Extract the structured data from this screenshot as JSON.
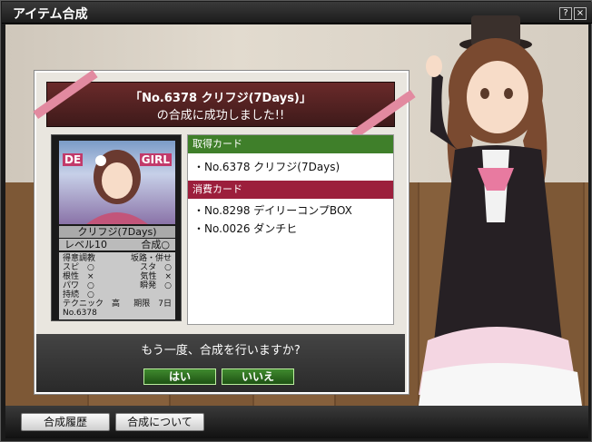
{
  "window": {
    "title": "アイテム合成",
    "help_label": "?",
    "close_label": "×"
  },
  "banner": {
    "line1": "「No.6378 クリフジ(7Days)」",
    "line2": "の合成に成功しました!!"
  },
  "card": {
    "art_text_left": "DE",
    "art_text_right": "GIRL",
    "name": "クリフジ(7Days)",
    "level": "レベル10",
    "status": "合成○",
    "stats": [
      {
        "l": "得意調教",
        "r": "坂路・併せ"
      },
      {
        "l": "スピ　○",
        "r": "スタ　○"
      },
      {
        "l": "根性　×",
        "r": "気性　×"
      },
      {
        "l": "パワ　○",
        "r": "瞬発　○"
      },
      {
        "l": "持続　○",
        "r": ""
      },
      {
        "l": "テクニック　高",
        "r": "期限　7日"
      }
    ],
    "number": "No.6378"
  },
  "acquired": {
    "header": "取得カード",
    "items": [
      "・No.6378 クリフジ(7Days)"
    ]
  },
  "consumed": {
    "header": "消費カード",
    "items": [
      "・No.8298 デイリーコンプBOX",
      "・No.0026 ダンチヒ"
    ]
  },
  "question": {
    "text": "もう一度、合成を行いますか?",
    "yes": "はい",
    "no": "いいえ"
  },
  "footer": {
    "history": "合成履歴",
    "about": "合成について"
  },
  "colors": {
    "acquired_header": "#3f7f2a",
    "consumed_header": "#9c1f3c"
  }
}
